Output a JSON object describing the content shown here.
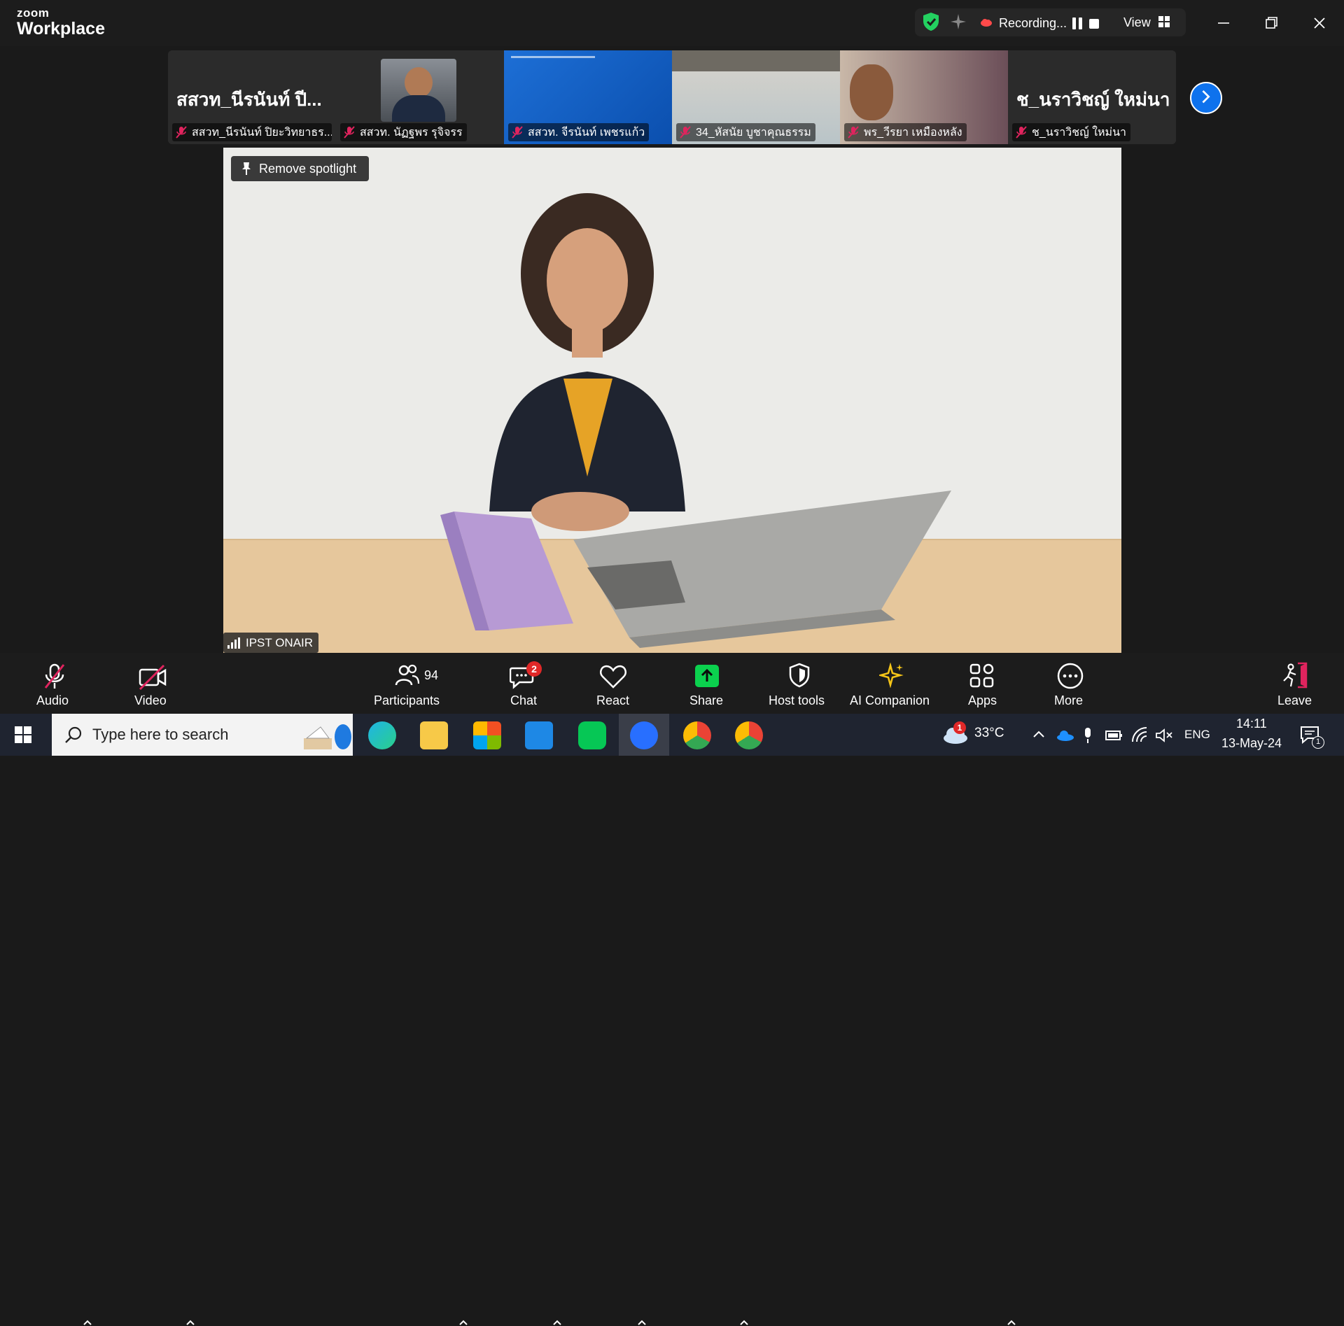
{
  "titlebar": {
    "logo_top": "zoom",
    "logo_bottom": "Workplace",
    "recording_label": "Recording...",
    "view_label": "View"
  },
  "thumbnails": [
    {
      "big_name": "สสวท_นีรนันท์ ปี...",
      "name": "สสวท_นีรนันท์ ปิยะวิทยาธร..."
    },
    {
      "big_name": "",
      "name": "สสวท. นัฏฐพร รุจิจรร"
    },
    {
      "big_name": "",
      "name": "สสวท. จีรนันท์ เพชรแก้ว"
    },
    {
      "big_name": "",
      "name": "34_หัสนัย บูชาคุณธรรม"
    },
    {
      "big_name": "",
      "name": "พร_วีรยา เหมืองหลัง"
    },
    {
      "big_name": "ช_นราวิชญ์ ใหม่นา",
      "name": "ช_นราวิชญ์ ใหม่นา"
    }
  ],
  "main_video": {
    "spotlight_button": "Remove spotlight",
    "speaker_label": "IPST ONAIR"
  },
  "toolbar": {
    "audio": "Audio",
    "video": "Video",
    "participants": "Participants",
    "participants_count": "94",
    "chat": "Chat",
    "chat_badge": "2",
    "react": "React",
    "share": "Share",
    "host_tools": "Host tools",
    "ai_companion": "AI Companion",
    "apps": "Apps",
    "more": "More",
    "leave": "Leave"
  },
  "taskbar": {
    "search_placeholder": "Type here to search",
    "weather_temp": "33°C",
    "weather_badge": "1",
    "language": "ENG",
    "time": "14:11",
    "date": "13-May-24",
    "notification_count": "1"
  },
  "colors": {
    "accent_blue": "#0e72ed",
    "share_green": "#0bd14e",
    "mute_red": "#e0245e",
    "ai_yellow": "#f5c518"
  }
}
